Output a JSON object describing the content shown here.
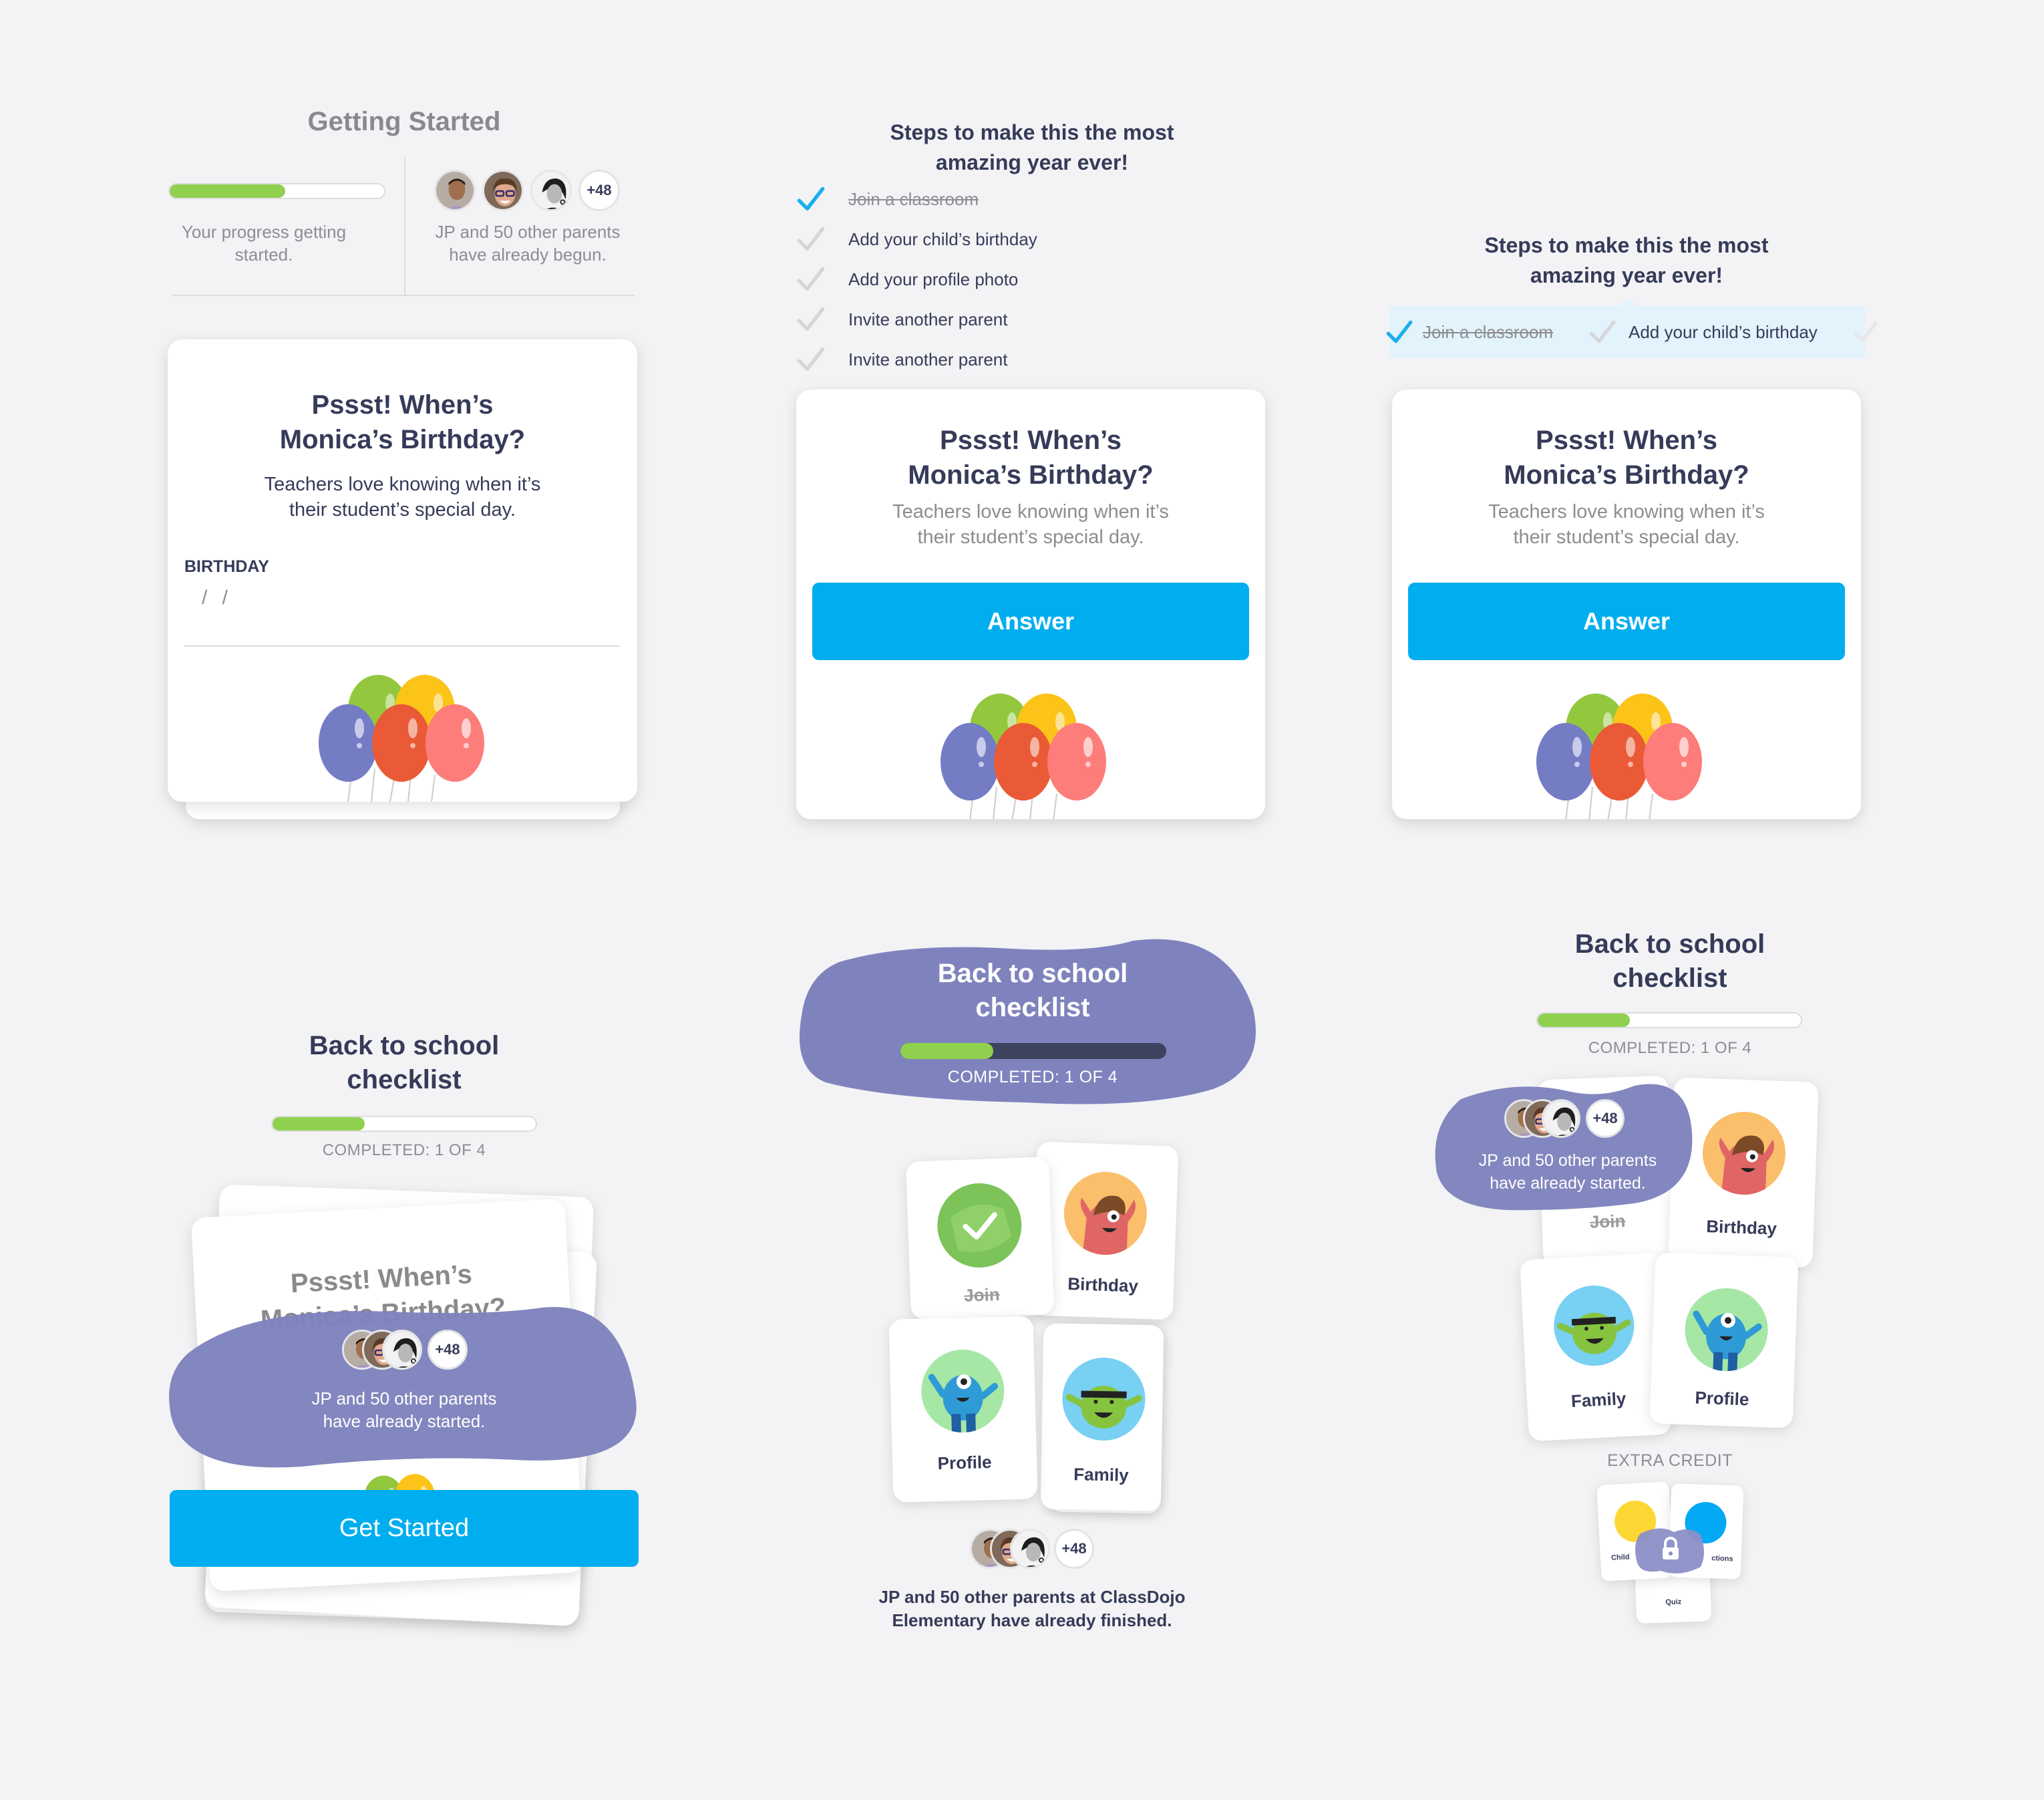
{
  "colors": {
    "background": "#f3f3f5",
    "primary_button": "#00aeef",
    "progress_fill": "#8fd14f",
    "blob_purple": "#7f83bd",
    "heading_dark": "#363b59",
    "muted_gray": "#8d8d92",
    "check_blue": "#1aaef0",
    "check_gray": "#d6d6d8",
    "balloon_colors": [
      "#93c83e",
      "#fcc419",
      "#747cc4",
      "#ea5a36",
      "#fd7d7a"
    ]
  },
  "social_proof": {
    "avatars": [
      "avatar-man",
      "avatar-woman-glasses",
      "avatar-woman-bw"
    ],
    "more_count": "+48"
  },
  "panel1": {
    "title": "Getting Started",
    "progress": 0.54,
    "progress_caption": "Your progress getting started.",
    "parents_caption": "JP and 50 other parents have already begun.",
    "card": {
      "title_line1": "Pssst! When’s",
      "title_line2": "Monica’s Birthday?",
      "subtitle_line1": "Teachers love knowing when it’s",
      "subtitle_line2": "their student’s special day.",
      "field_label": "BIRTHDAY",
      "field_value": "/ /"
    }
  },
  "panel2": {
    "heading_line1": "Steps to make this the most",
    "heading_line2": "amazing year ever!",
    "steps": [
      {
        "label": "Join a classroom",
        "done": true
      },
      {
        "label": "Add your child’s birthday",
        "done": false
      },
      {
        "label": "Add your profile photo",
        "done": false
      },
      {
        "label": "Invite another parent",
        "done": false
      },
      {
        "label": "Invite another parent",
        "done": false
      }
    ],
    "card": {
      "title_line1": "Pssst! When’s",
      "title_line2": "Monica’s Birthday?",
      "subtitle_line1": "Teachers love knowing when it’s",
      "subtitle_line2": "their student’s special day.",
      "button": "Answer"
    }
  },
  "panel3": {
    "heading_line1": "Steps to make this the most",
    "heading_line2": "amazing year ever!",
    "steps": [
      {
        "label": "Join a classroom",
        "done": true
      },
      {
        "label": "Add your child’s birthday",
        "done": false
      }
    ],
    "card": {
      "title_line1": "Pssst! When’s",
      "title_line2": "Monica’s Birthday?",
      "subtitle_line1": "Teachers love knowing when it’s",
      "subtitle_line2": "their student’s special day.",
      "button": "Answer"
    }
  },
  "panel4": {
    "title_line1": "Back to school",
    "title_line2": "checklist",
    "progress": 0.35,
    "completed": "COMPLETED: 1 OF 4",
    "behind_card_title_line1": "Pssst! When’s",
    "behind_card_title_line2": "Monica’s Birthday?",
    "blob_line1": "JP and 50 other parents",
    "blob_line2": "have already started.",
    "button": "Get Started"
  },
  "panel5": {
    "title_line1": "Back to school",
    "title_line2": "checklist",
    "progress": 0.35,
    "completed": "COMPLETED: 1 OF 4",
    "tiles": [
      {
        "label": "Join",
        "done": true,
        "icon": "unicorn-check-icon"
      },
      {
        "label": "Birthday",
        "done": false,
        "icon": "birthday-monster-icon"
      },
      {
        "label": "Profile",
        "done": false,
        "icon": "profile-monster-icon"
      },
      {
        "label": "Family",
        "done": false,
        "icon": "family-monster-icon"
      }
    ],
    "footer_line1": "JP and 50 other parents at ClassDojo",
    "footer_line2": "Elementary have already finished."
  },
  "panel6": {
    "title_line1": "Back to school",
    "title_line2": "checklist",
    "progress": 0.35,
    "completed": "COMPLETED: 1 OF 4",
    "blob_line1": "JP and 50 other parents",
    "blob_line2": "have already started.",
    "tiles": [
      {
        "label": "Join",
        "done": true
      },
      {
        "label": "Birthday",
        "done": false
      },
      {
        "label": "Family",
        "done": false
      },
      {
        "label": "Profile",
        "done": false
      }
    ],
    "extra_credit_label": "EXTRA CREDIT",
    "extra_cards": [
      {
        "label": "Child",
        "color": "#fdd835"
      },
      {
        "label": "ctions",
        "color": "#03a9f4"
      },
      {
        "label": "Quiz",
        "color": "#f26b6b"
      }
    ],
    "lock_icon": "lock-icon"
  }
}
